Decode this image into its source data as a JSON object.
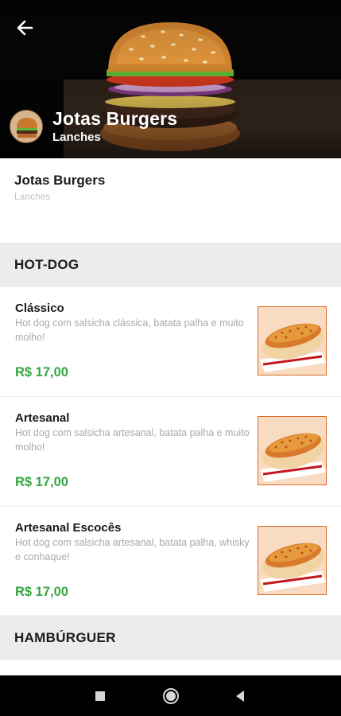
{
  "header": {
    "back_icon": "arrow-left-icon",
    "title": "Jotas Burgers",
    "subtitle": "Lanches"
  },
  "store": {
    "name": "Jotas Burgers",
    "category": "Lanches"
  },
  "sections": [
    {
      "title": "HOT-DOG",
      "items": [
        {
          "name": "Clássico",
          "description": "Hot dog com salsicha clássica, batata palha e muito molho!",
          "price": "R$ 17,00"
        },
        {
          "name": "Artesanal",
          "description": "Hot dog com salsicha artesanal, batata palha e muito molho!",
          "price": "R$ 17,00"
        },
        {
          "name": "Artesanal Escocês",
          "description": "Hot dog com salsicha artesanal, batata palha, whisky e conhaque!",
          "price": "R$ 17,00"
        }
      ]
    },
    {
      "title": "HAMBÚRGUER",
      "items": []
    }
  ],
  "colors": {
    "price": "#35a540",
    "section_bg": "#ececec",
    "thumb_border": "#d96b2a"
  },
  "navbar": {
    "recents_icon": "square-icon",
    "home_icon": "circle-home-icon",
    "back_icon": "triangle-back-icon"
  }
}
